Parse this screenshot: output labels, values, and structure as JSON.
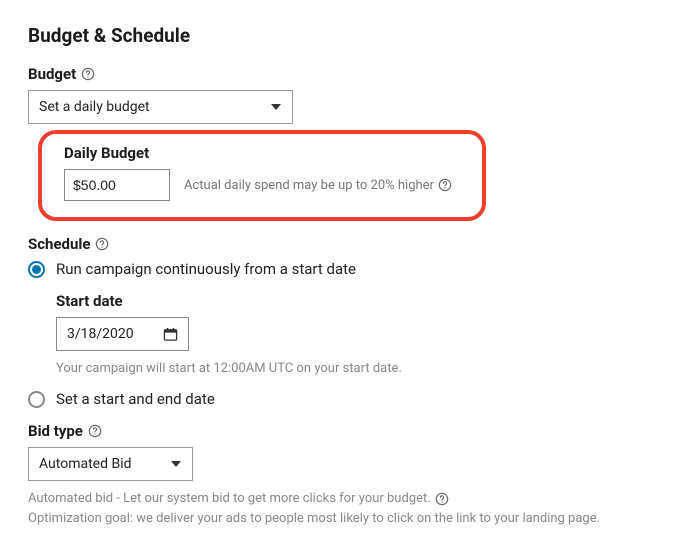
{
  "section_title": "Budget & Schedule",
  "budget": {
    "label": "Budget",
    "select_value": "Set a daily budget",
    "daily_label": "Daily Budget",
    "daily_value": "$50.00",
    "daily_hint": "Actual daily spend may be up to 20% higher"
  },
  "schedule": {
    "label": "Schedule",
    "option_continuous": "Run campaign continuously from a start date",
    "start_date_label": "Start date",
    "start_date_value": "3/18/2020",
    "start_hint": "Your campaign will start at 12:00AM UTC on your start date.",
    "option_range": "Set a start and end date"
  },
  "bid": {
    "label": "Bid type",
    "select_value": "Automated Bid",
    "hint1": "Automated bid - Let our system bid to get more clicks for your budget.",
    "hint2": "Optimization goal: we deliver your ads to people most likely to click on the link to your landing page."
  }
}
